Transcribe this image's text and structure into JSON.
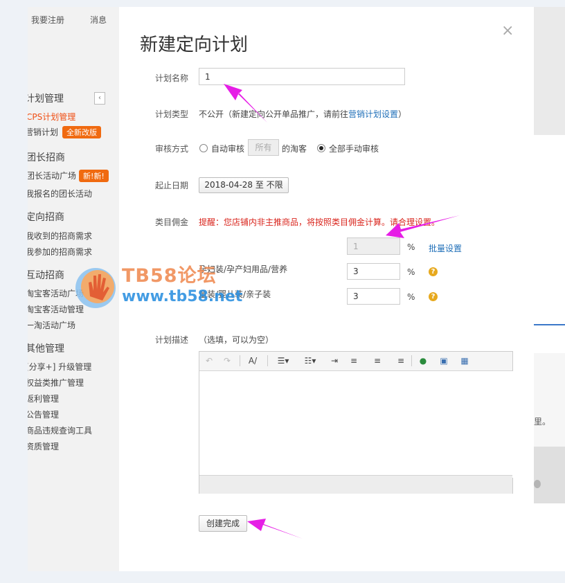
{
  "nav": {
    "register": "我要注册",
    "messages": "消息",
    "collapse_glyph": "‹",
    "sections": [
      {
        "title": "计划管理",
        "items": [
          {
            "label": "CPS计划管理",
            "active": true,
            "badge": ""
          },
          {
            "label": "营销计划",
            "active": false,
            "badge": "全新改版"
          }
        ]
      },
      {
        "title": "团长招商",
        "items": [
          {
            "label": "团长活动广场",
            "active": false,
            "badge": "新!新!"
          },
          {
            "label": "我报名的团长活动",
            "active": false,
            "badge": ""
          }
        ]
      },
      {
        "title": "定向招商",
        "items": [
          {
            "label": "我收到的招商需求",
            "active": false,
            "badge": ""
          },
          {
            "label": "我参加的招商需求",
            "active": false,
            "badge": ""
          }
        ]
      },
      {
        "title": "互动招商",
        "items": [
          {
            "label": "淘宝客活动广场",
            "active": false,
            "badge": ""
          },
          {
            "label": "淘宝客活动管理",
            "active": false,
            "badge": ""
          },
          {
            "label": "一淘活动广场",
            "active": false,
            "badge": ""
          }
        ]
      },
      {
        "title": "其他管理",
        "items": [
          {
            "label": "[分享+] 升级管理",
            "active": false,
            "badge": ""
          },
          {
            "label": "权益类推广管理",
            "active": false,
            "badge": ""
          },
          {
            "label": "返利管理",
            "active": false,
            "badge": ""
          },
          {
            "label": "公告管理",
            "active": false,
            "badge": ""
          },
          {
            "label": "商品违规查询工具",
            "active": false,
            "badge": ""
          },
          {
            "label": "资质管理",
            "active": false,
            "badge": ""
          }
        ]
      }
    ]
  },
  "background_right": {
    "fragment_text": "里。"
  },
  "dialog": {
    "title": "新建定向计划",
    "close_glyph": "×",
    "plan_name": {
      "label": "计划名称",
      "value": "1"
    },
    "plan_type": {
      "label": "计划类型",
      "text_before": "不公开（新建定向公开单品推广，请前往",
      "link": "营销计划设置",
      "text_after": "）"
    },
    "review": {
      "label": "审核方式",
      "auto_label": "自动审核",
      "select_value": "所有",
      "suffix": "的淘客",
      "manual_label": "全部手动审核",
      "selected": "manual"
    },
    "dates": {
      "label": "起止日期",
      "button": "2018-04-28 至 不限"
    },
    "commission": {
      "label": "类目佣金",
      "notice": "提醒：您店铺内非主推商品，将按照类目佣金计算。请合理设置。",
      "batch_value": "1",
      "percent": "%",
      "batch_link": "批量设置",
      "help_glyph": "?",
      "categories": [
        {
          "name": "孕妇装/孕产妇用品/营养",
          "value": "3"
        },
        {
          "name": "童装/婴儿装/亲子装",
          "value": "3"
        }
      ]
    },
    "description": {
      "label": "计划描述",
      "hint": "（选填，可以为空）"
    },
    "toolbar": {
      "undo": "↶",
      "redo": "↷",
      "format": "A/",
      "bullet": "☰▾",
      "numbered": "☷▾",
      "indent": "⇥",
      "align_left": "≡",
      "align_center": "≡",
      "align_right": "≡",
      "link": "●",
      "image": "▣",
      "table": "▦"
    },
    "submit": "创建完成"
  },
  "watermark": {
    "title": "TB58论坛",
    "url": "www.tb58.net"
  },
  "colors": {
    "accent_orange": "#f06a10",
    "active_red": "#f04e13",
    "link_blue": "#1f6fb8",
    "annotation_magenta": "#e61ee6"
  }
}
